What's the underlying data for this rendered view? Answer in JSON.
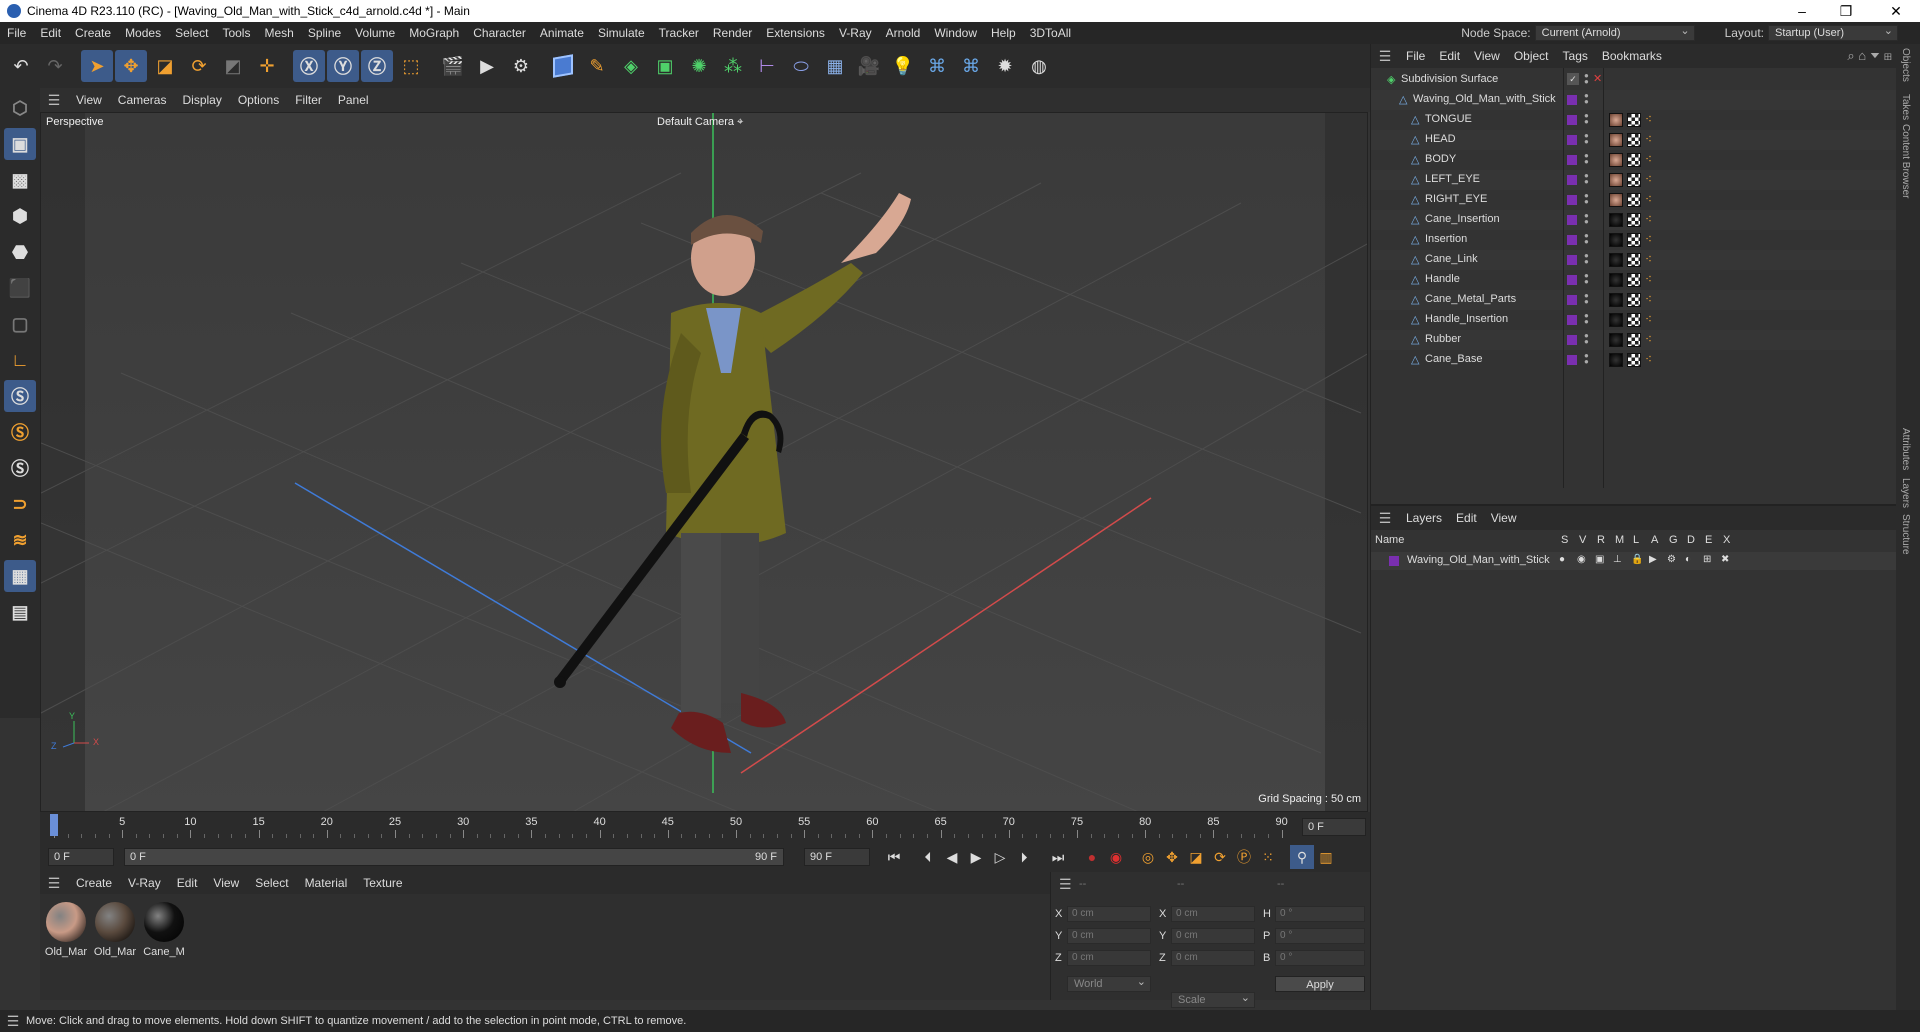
{
  "window": {
    "title": "Cinema 4D R23.110 (RC) - [Waving_Old_Man_with_Stick_c4d_arnold.c4d *] - Main",
    "controls": [
      "–",
      "❐",
      "✕"
    ]
  },
  "menubar": {
    "items": [
      "File",
      "Edit",
      "Create",
      "Modes",
      "Select",
      "Tools",
      "Mesh",
      "Spline",
      "Volume",
      "MoGraph",
      "Character",
      "Animate",
      "Simulate",
      "Tracker",
      "Render",
      "Extensions",
      "V-Ray",
      "Arnold",
      "Window",
      "Help",
      "3DToAll"
    ],
    "node_space_label": "Node Space:",
    "node_space_value": "Current (Arnold)",
    "layout_label": "Layout:",
    "layout_value": "Startup (User)"
  },
  "viewport": {
    "menu": [
      "View",
      "Cameras",
      "Display",
      "Options",
      "Filter",
      "Panel"
    ],
    "label": "Perspective",
    "camera": "Default Camera",
    "grid_spacing": "Grid Spacing : 50 cm",
    "axis_x": "X",
    "axis_y": "Y",
    "axis_z": "Z"
  },
  "timeline": {
    "ticks": [
      "0",
      "5",
      "10",
      "15",
      "20",
      "25",
      "30",
      "35",
      "40",
      "45",
      "50",
      "55",
      "60",
      "65",
      "70",
      "75",
      "80",
      "85",
      "90"
    ],
    "current_frame": "0 F",
    "start_field": "0 F",
    "range_start": "0 F",
    "range_end": "90 F",
    "end_field": "90 F"
  },
  "materials": {
    "menu": [
      "Create",
      "V-Ray",
      "Edit",
      "View",
      "Select",
      "Material",
      "Texture"
    ],
    "items": [
      {
        "label": "Old_Mar",
        "color": "#c89a86"
      },
      {
        "label": "Old_Mar",
        "color": "#5a4a3e"
      },
      {
        "label": "Cane_M",
        "color": "#111111"
      }
    ]
  },
  "coords": {
    "header_a": "--",
    "header_b": "--",
    "header_c": "--",
    "rows": [
      {
        "l1": "X",
        "v1": "0 cm",
        "l2": "X",
        "v2": "0 cm",
        "l3": "H",
        "v3": "0 °"
      },
      {
        "l1": "Y",
        "v1": "0 cm",
        "l2": "Y",
        "v2": "0 cm",
        "l3": "P",
        "v3": "0 °"
      },
      {
        "l1": "Z",
        "v1": "0 cm",
        "l2": "Z",
        "v2": "0 cm",
        "l3": "B",
        "v3": "0 °"
      }
    ],
    "mode": "World",
    "scale": "Scale",
    "apply": "Apply"
  },
  "status": "Move: Click and drag to move elements. Hold down SHIFT to quantize movement / add to the selection in point mode, CTRL to remove.",
  "objects": {
    "menu": [
      "File",
      "Edit",
      "View",
      "Object",
      "Tags",
      "Bookmarks"
    ],
    "root": "Subdivision Surface",
    "group": "Waving_Old_Man_with_Stick",
    "children": [
      "TONGUE",
      "HEAD",
      "BODY",
      "LEFT_EYE",
      "RIGHT_EYE",
      "Cane_Insertion",
      "Insertion",
      "Cane_Link",
      "Handle",
      "Cane_Metal_Parts",
      "Handle_Insertion",
      "Rubber",
      "Cane_Base"
    ]
  },
  "layers": {
    "menu": [
      "Layers",
      "Edit",
      "View"
    ],
    "col_name": "Name",
    "cols": [
      "S",
      "V",
      "R",
      "M",
      "L",
      "A",
      "G",
      "D",
      "E",
      "X"
    ],
    "rows": [
      "Waving_Old_Man_with_Stick"
    ]
  },
  "sidetabs": [
    "Objects",
    "Takes",
    "Content Browser",
    "Attributes",
    "Layers",
    "Structure"
  ]
}
